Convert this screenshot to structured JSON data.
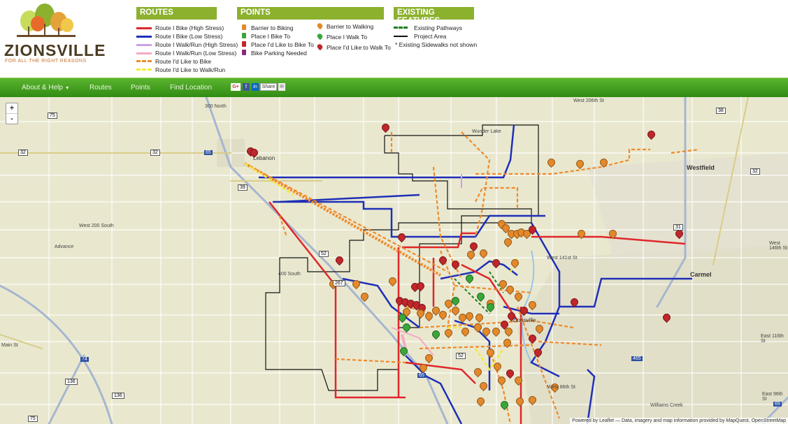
{
  "header": {
    "logo_word": "ZIONSVILLE",
    "logo_tagline": "FOR ALL THE RIGHT REASONS",
    "routes_title": "ROUTES",
    "routes": [
      {
        "label": "Route I Bike (High Stress)",
        "color": "#e0262a",
        "style": "solid"
      },
      {
        "label": "Route I Bike (Low Stress)",
        "color": "#1f2fb8",
        "style": "solid"
      },
      {
        "label": "Route I Walk/Run (High Stress)",
        "color": "#c9a2e6",
        "style": "solid"
      },
      {
        "label": "Route I Walk/Run (Low Stress)",
        "color": "#f6a8c8",
        "style": "solid"
      },
      {
        "label": "Route I'd Like to Bike",
        "color": "#ef8a2b",
        "style": "dashed"
      },
      {
        "label": "Route I'd Like to Walk/Run",
        "color": "#f2ea3a",
        "style": "dashed"
      }
    ],
    "points_title": "POINTS",
    "points_col1": [
      {
        "label": "Barrier to Biking",
        "color": "#e4892a"
      },
      {
        "label": "Place I Bike To",
        "color": "#3aa63a"
      },
      {
        "label": "Place I'd Like to Bike To",
        "color": "#c0262a"
      },
      {
        "label": "Bike Parking Needed",
        "color": "#8a2a7a"
      }
    ],
    "points_col2": [
      {
        "label": "Barrier to Walking",
        "color": "#e4892a"
      },
      {
        "label": "Place I Walk To",
        "color": "#3aa63a"
      },
      {
        "label": "Place I'd Like to Walk To",
        "color": "#c0262a"
      }
    ],
    "features_title": "EXISTING FEATURES",
    "features": [
      {
        "label": "Existing Pathways",
        "color": "#1c7d1c",
        "style": "dashed"
      },
      {
        "label": "Project Area",
        "color": "#111111",
        "style": "solid"
      }
    ],
    "features_note": "* Existing Sidewalks not shown"
  },
  "nav": {
    "about": "About & Help",
    "routes": "Routes",
    "points": "Points",
    "find": "Find Location",
    "share": "Share"
  },
  "map": {
    "zoom_in": "+",
    "zoom_out": "-",
    "attribution": "Powered by Leaflet — Data, imagery and map information provided by MapQuest, OpenStreetMap",
    "labels": [
      {
        "text": "Westfield"
      },
      {
        "text": "Carmel"
      },
      {
        "text": "Lebanon"
      },
      {
        "text": "Zionsville"
      },
      {
        "text": "Advance"
      },
      {
        "text": "Wunder Lake"
      },
      {
        "text": "West 200 South"
      },
      {
        "text": "400 South"
      },
      {
        "text": "300 North"
      },
      {
        "text": "West 206th St"
      },
      {
        "text": "West 141st St"
      },
      {
        "text": "Williams Creek"
      },
      {
        "text": "Main St"
      },
      {
        "text": "West 146th St"
      },
      {
        "text": "East 116th St"
      },
      {
        "text": "East 96th St"
      },
      {
        "text": "West 86th St"
      }
    ],
    "shields": [
      "75",
      "32",
      "32",
      "65",
      "39",
      "38",
      "32",
      "31",
      "74",
      "136",
      "136",
      "75",
      "52",
      "52",
      "65",
      "465",
      "69",
      "267"
    ]
  }
}
